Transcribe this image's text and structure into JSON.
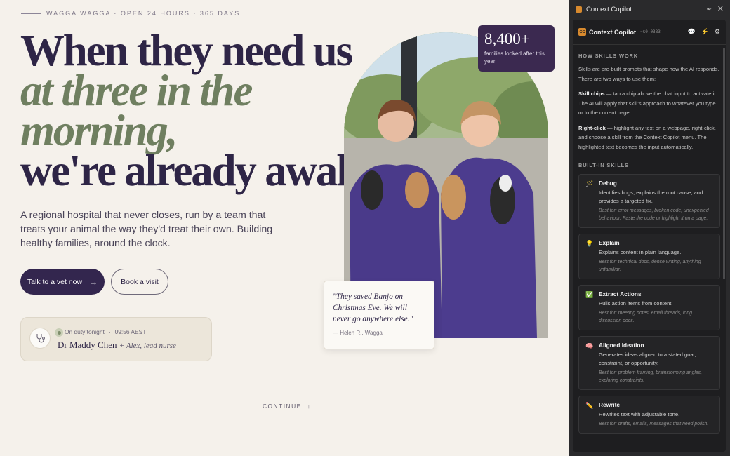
{
  "hero": {
    "topline": "WAGGA WAGGA · OPEN 24 HOURS · 365 DAYS",
    "headline_l1": "When they need us",
    "headline_l2": "at three in the",
    "headline_l3": "morning,",
    "headline_l4a": "we're already ",
    "headline_l4b": "awake.",
    "lede": "A regional hospital that never closes, run by a team that treats your animal the way they'd treat their own. Building healthy families, around the clock.",
    "cta_primary": "Talk to a vet now",
    "cta_primary_arrow": "→",
    "cta_secondary": "Book a visit"
  },
  "duty": {
    "status": "On duty tonight",
    "time": "09:56 AEST",
    "doctor": "Dr Maddy Chen",
    "assistant": "+ Alex, lead nurse"
  },
  "stat": {
    "value": "8,400+",
    "label": "families looked after this year"
  },
  "quote": {
    "text": "\"They saved Banjo on Christmas Eve. We will never go anywhere else.\"",
    "author": "— Helen R., Wagga"
  },
  "continue_label": "CONTINUE",
  "panel": {
    "window_title": "Context Copilot",
    "header_name": "Context Copilot",
    "logo_text": "CC",
    "cost": "~$0.0383",
    "how_title": "HOW SKILLS WORK",
    "how_intro": "Skills are pre-built prompts that shape how the AI responds. There are two ways to use them:",
    "chips_label": "Skill chips",
    "chips_text": " — tap a chip above the chat input to activate it. The AI will apply that skill's approach to whatever you type or to the current page.",
    "rightclick_label": "Right-click",
    "rightclick_text": " — highlight any text on a webpage, right-click, and choose a skill from the Context Copilot menu. The highlighted text becomes the input automatically.",
    "builtin_title": "BUILT-IN SKILLS",
    "skills": [
      {
        "icon": "🪄",
        "name": "Debug",
        "desc": "Identifies bugs, explains the root cause, and provides a targeted fix.",
        "best": "Best for: error messages, broken code, unexpected behaviour. Paste the code or highlight it on a page."
      },
      {
        "icon": "💡",
        "name": "Explain",
        "desc": "Explains content in plain language.",
        "best": "Best for: technical docs, dense writing, anything unfamiliar."
      },
      {
        "icon": "✅",
        "name": "Extract Actions",
        "desc": "Pulls action items from content.",
        "best": "Best for: meeting notes, email threads, long discussion docs."
      },
      {
        "icon": "🧠",
        "name": "Aligned Ideation",
        "desc": "Generates ideas aligned to a stated goal, constraint, or opportunity.",
        "best": "Best for: problem framing, brainstorming angles, exploring constraints."
      },
      {
        "icon": "✏️",
        "name": "Rewrite",
        "desc": "Rewrites text with adjustable tone.",
        "best": "Best for: drafts, emails, messages that need polish."
      }
    ]
  }
}
